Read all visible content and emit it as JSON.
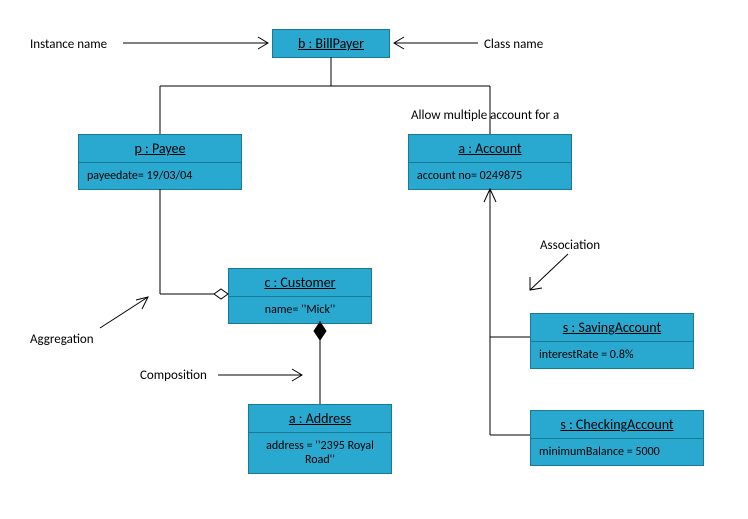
{
  "labels": {
    "instance_name": "Instance name",
    "class_name": "Class name",
    "allow_multiple": "Allow multiple account for a",
    "aggregation": "Aggregation",
    "composition": "Composition",
    "association": "Association"
  },
  "objects": {
    "billpayer": {
      "title": "b : BillPayer"
    },
    "payee": {
      "title": "p : Payee",
      "attr": "payeedate= 19/03/04"
    },
    "account": {
      "title": "a : Account",
      "attr": "account no= 0249875"
    },
    "customer": {
      "title": "c : Customer",
      "attr": "name= ''Mick''"
    },
    "saving": {
      "title": "s : SavingAccount",
      "attr": "interestRate = 0.8%"
    },
    "checking": {
      "title": "s : CheckingAccount",
      "attr": "minimumBalance = 5000"
    },
    "address": {
      "title": "a : Address",
      "attr": "address = ''2395 Royal Road''"
    }
  }
}
